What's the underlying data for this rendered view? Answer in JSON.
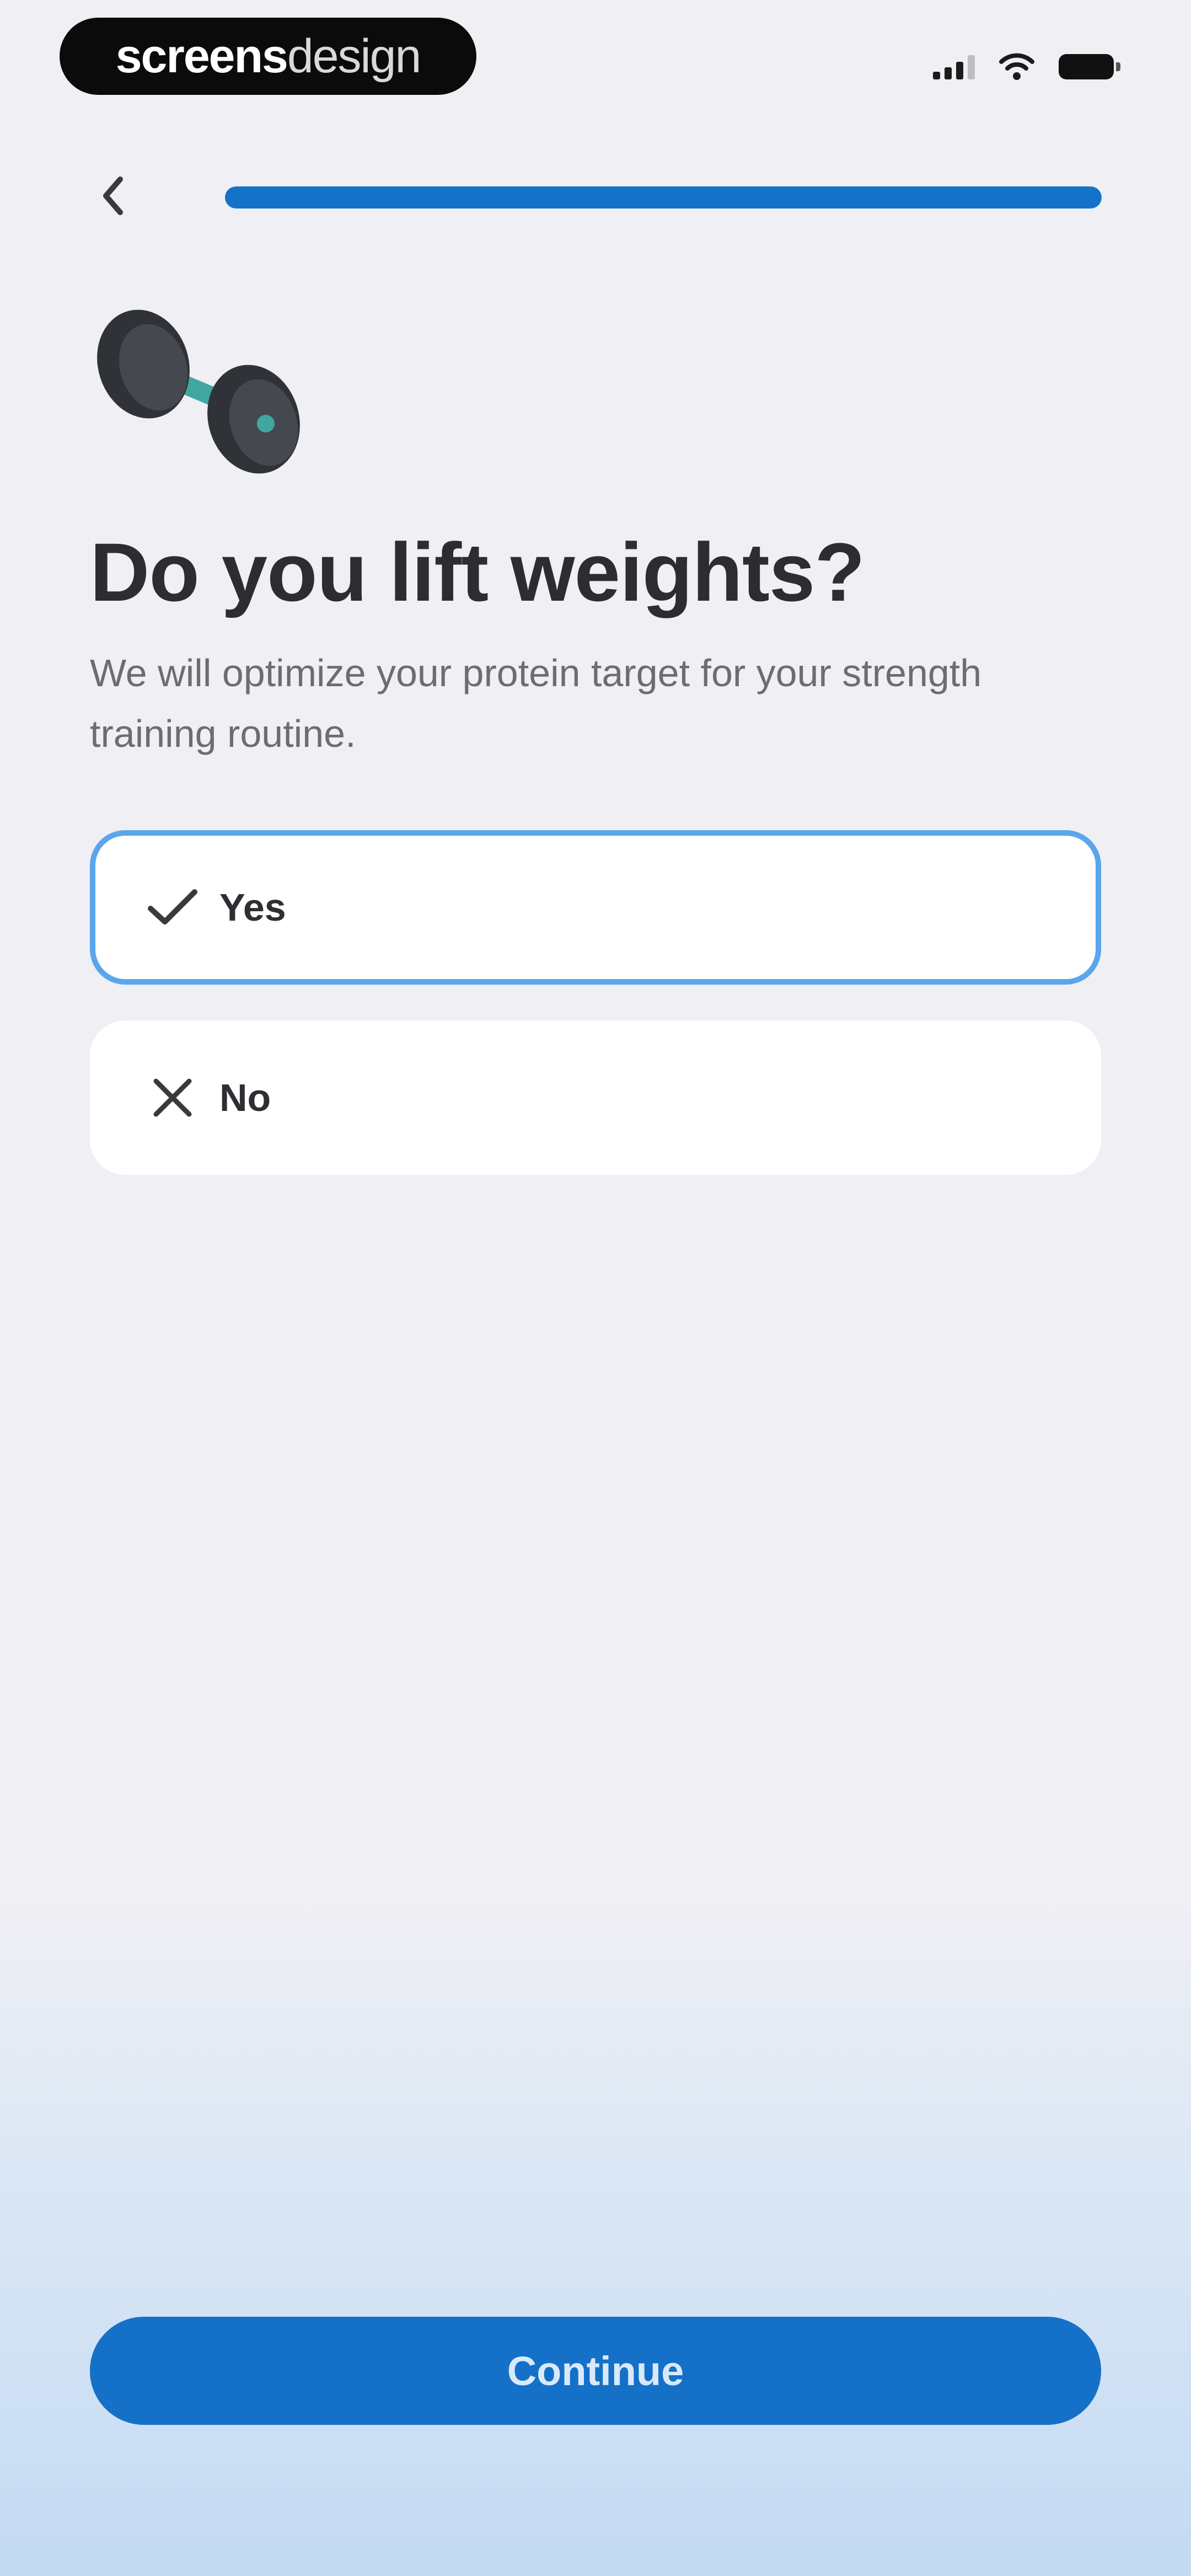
{
  "status_bar": {
    "brand_part_a": "screens",
    "brand_part_b": "design",
    "icons": [
      "cellular-signal-icon",
      "wifi-icon",
      "battery-icon"
    ]
  },
  "nav": {
    "back_icon": "chevron-left-icon",
    "progress_fraction": 1.0
  },
  "illustration": {
    "icon": "dumbbell-icon"
  },
  "question": {
    "title": "Do you lift weights?",
    "subtitle": "We will optimize your protein target for your strength training routine."
  },
  "options": [
    {
      "label": "Yes",
      "icon": "checkmark-icon",
      "selected": true
    },
    {
      "label": "No",
      "icon": "x-icon",
      "selected": false
    }
  ],
  "footer": {
    "continue_label": "Continue"
  },
  "colors": {
    "accent": "#1570c8",
    "selected_border": "#5aa6ec",
    "background": "#efeff4",
    "dumbbell_handle": "#3fa6a0"
  }
}
